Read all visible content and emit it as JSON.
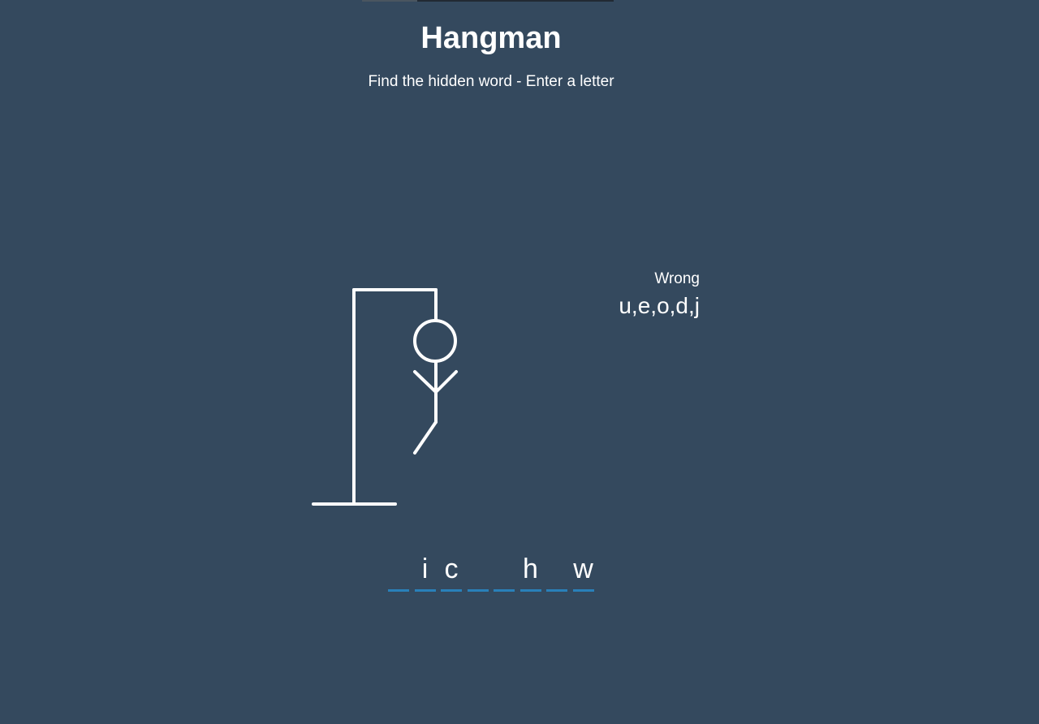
{
  "game": {
    "title": "Hangman",
    "subtitle": "Find the hidden word - Enter a letter",
    "wrong_label": "Wrong",
    "wrong_letters": "u,e,o,d,j",
    "wrong_count": 5,
    "word_slots": [
      "",
      "i",
      "c",
      "",
      "",
      "h",
      "",
      "w"
    ]
  },
  "colors": {
    "background": "#34495e",
    "text": "#ffffff",
    "slot_underline": "#2980b9",
    "drawing_stroke": "#ffffff"
  }
}
